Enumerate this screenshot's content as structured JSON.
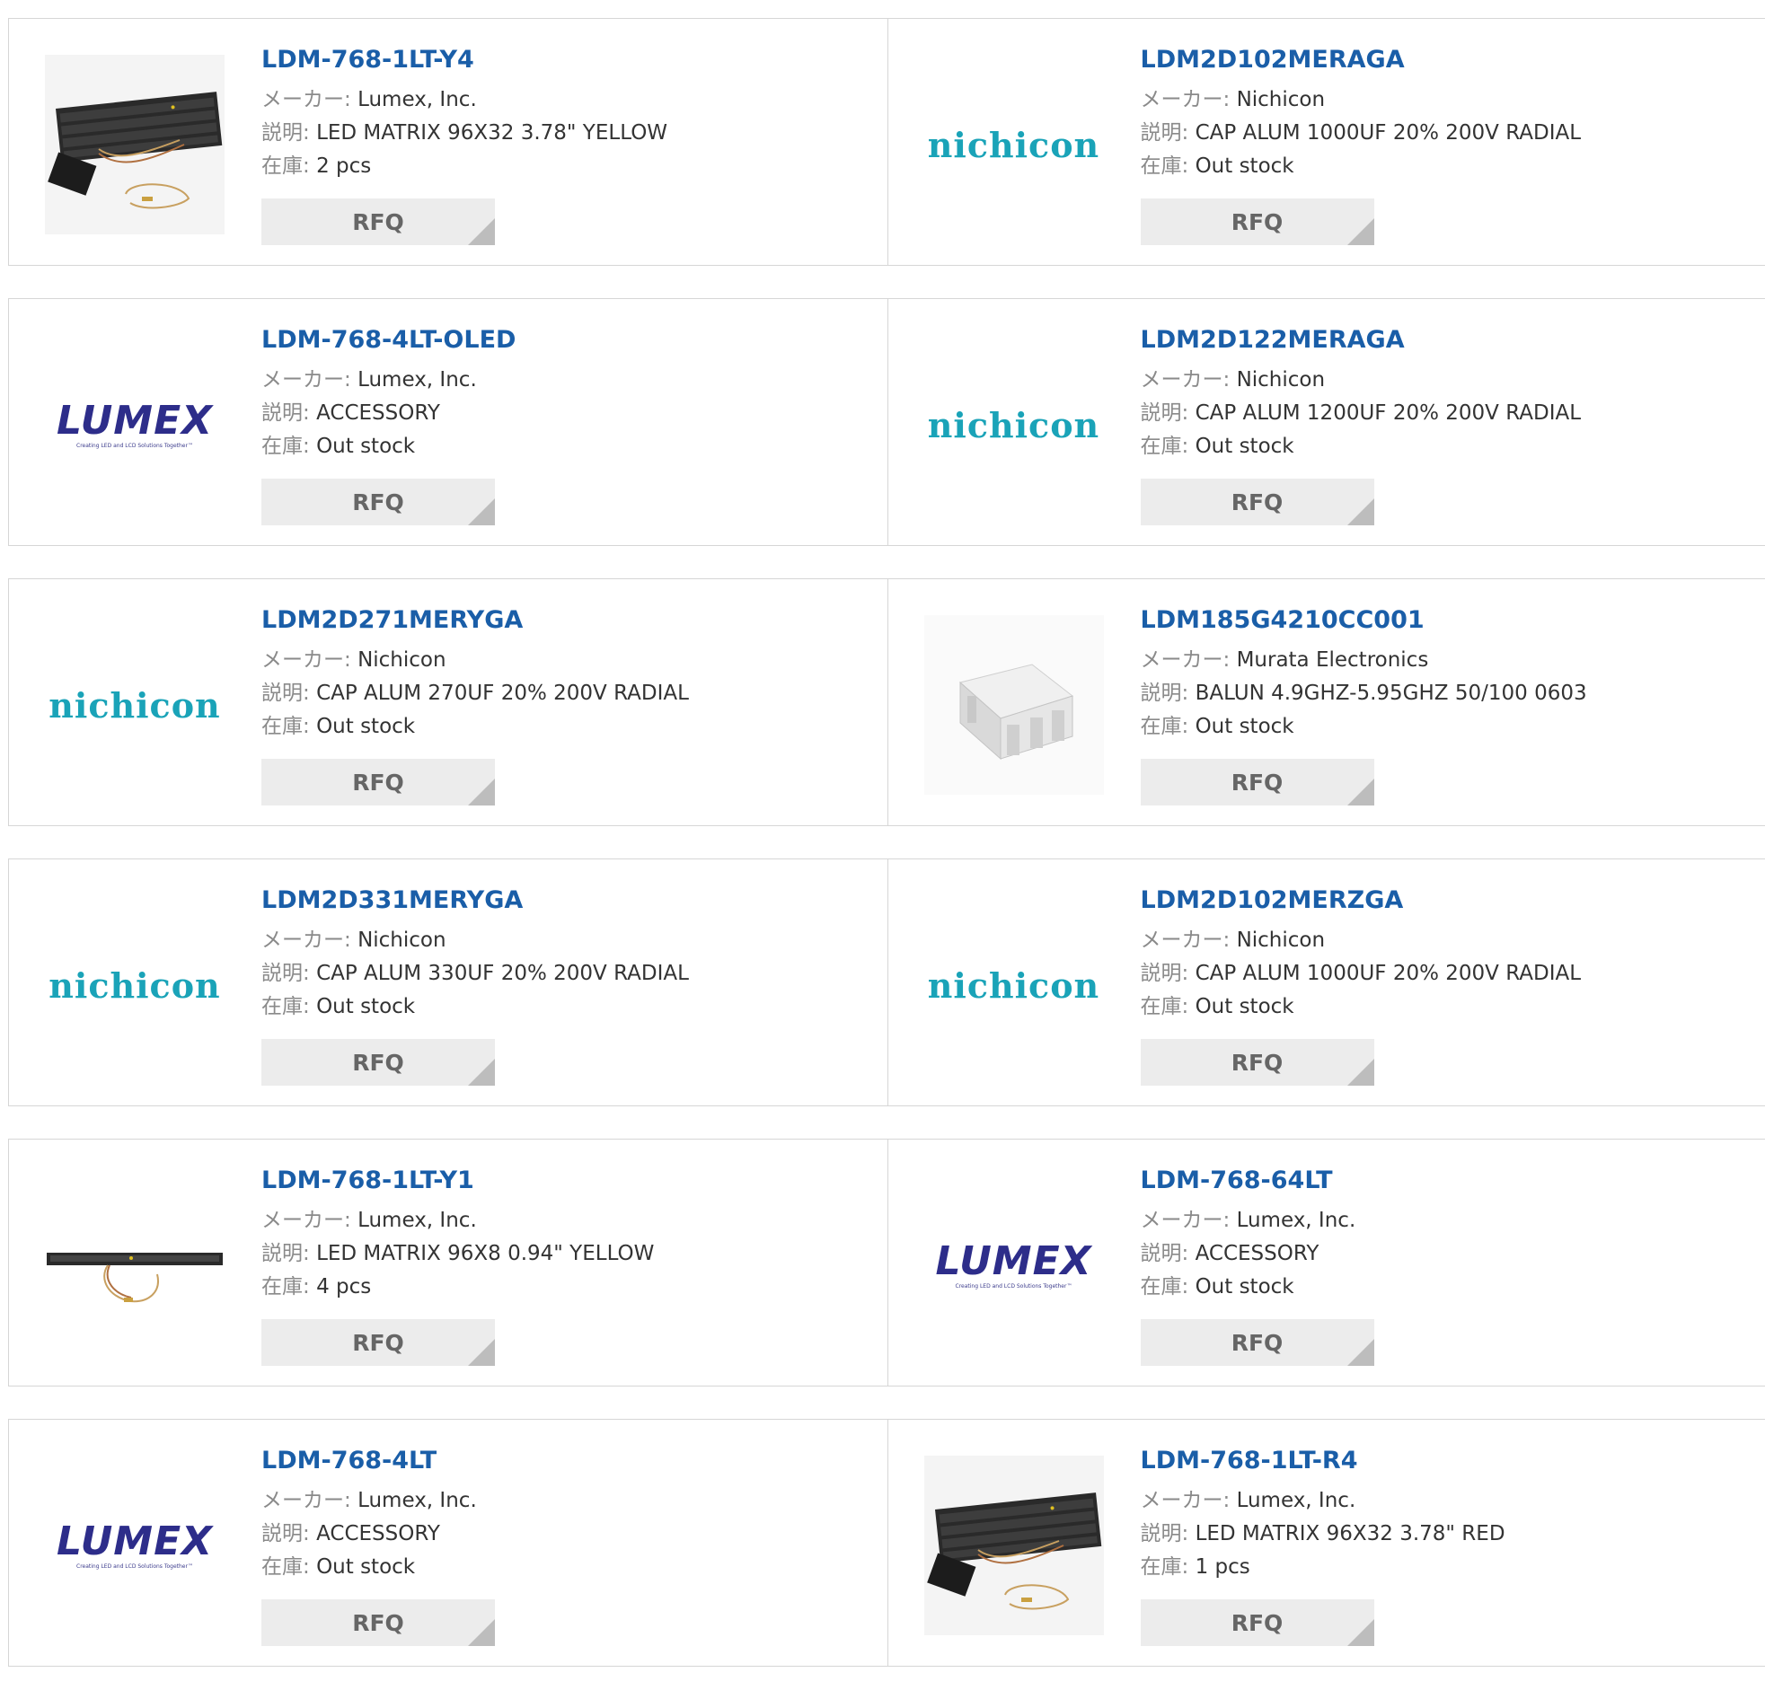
{
  "labels": {
    "maker": "メーカー:",
    "description": "説明:",
    "stock": "在庫:",
    "rfq": "RFQ"
  },
  "logos": {
    "nichicon": "nichicon",
    "lumex": "LUMEX",
    "lumex_tagline": "Creating LED and LCD Solutions Together™"
  },
  "colors": {
    "link": "#1a5ea8",
    "nichicon": "#1aa3b8",
    "lumex": "#2d2d8a",
    "rfq_bg": "#ececec",
    "border": "#d6d6d6"
  },
  "products": [
    {
      "part": "LDM-768-1LT-Y4",
      "maker": "Lumex, Inc.",
      "description": "LED MATRIX 96X32 3.78\" YELLOW",
      "stock": "2 pcs",
      "thumb": "led-matrix-large-photo"
    },
    {
      "part": "LDM2D102MERAGA",
      "maker": "Nichicon",
      "description": "CAP ALUM 1000UF 20% 200V RADIAL",
      "stock": "Out stock",
      "thumb": "nichicon-logo"
    },
    {
      "part": "LDM-768-4LT-OLED",
      "maker": "Lumex, Inc.",
      "description": "ACCESSORY",
      "stock": "Out stock",
      "thumb": "lumex-logo"
    },
    {
      "part": "LDM2D122MERAGA",
      "maker": "Nichicon",
      "description": "CAP ALUM 1200UF 20% 200V RADIAL",
      "stock": "Out stock",
      "thumb": "nichicon-logo"
    },
    {
      "part": "LDM2D271MERYGA",
      "maker": "Nichicon",
      "description": "CAP ALUM 270UF 20% 200V RADIAL",
      "stock": "Out stock",
      "thumb": "nichicon-logo"
    },
    {
      "part": "LDM185G4210CC001",
      "maker": "Murata Electronics",
      "description": "BALUN 4.9GHZ-5.95GHZ 50/100 0603",
      "stock": "Out stock",
      "thumb": "balun-chip-photo"
    },
    {
      "part": "LDM2D331MERYGA",
      "maker": "Nichicon",
      "description": "CAP ALUM 330UF 20% 200V RADIAL",
      "stock": "Out stock",
      "thumb": "nichicon-logo"
    },
    {
      "part": "LDM2D102MERZGA",
      "maker": "Nichicon",
      "description": "CAP ALUM 1000UF 20% 200V RADIAL",
      "stock": "Out stock",
      "thumb": "nichicon-logo"
    },
    {
      "part": "LDM-768-1LT-Y1",
      "maker": "Lumex, Inc.",
      "description": "LED MATRIX 96X8 0.94\" YELLOW",
      "stock": "4 pcs",
      "thumb": "led-matrix-strip-photo"
    },
    {
      "part": "LDM-768-64LT",
      "maker": "Lumex, Inc.",
      "description": "ACCESSORY",
      "stock": "Out stock",
      "thumb": "lumex-logo"
    },
    {
      "part": "LDM-768-4LT",
      "maker": "Lumex, Inc.",
      "description": "ACCESSORY",
      "stock": "Out stock",
      "thumb": "lumex-logo"
    },
    {
      "part": "LDM-768-1LT-R4",
      "maker": "Lumex, Inc.",
      "description": "LED MATRIX 96X32 3.78\" RED",
      "stock": "1 pcs",
      "thumb": "led-matrix-large-photo"
    }
  ]
}
